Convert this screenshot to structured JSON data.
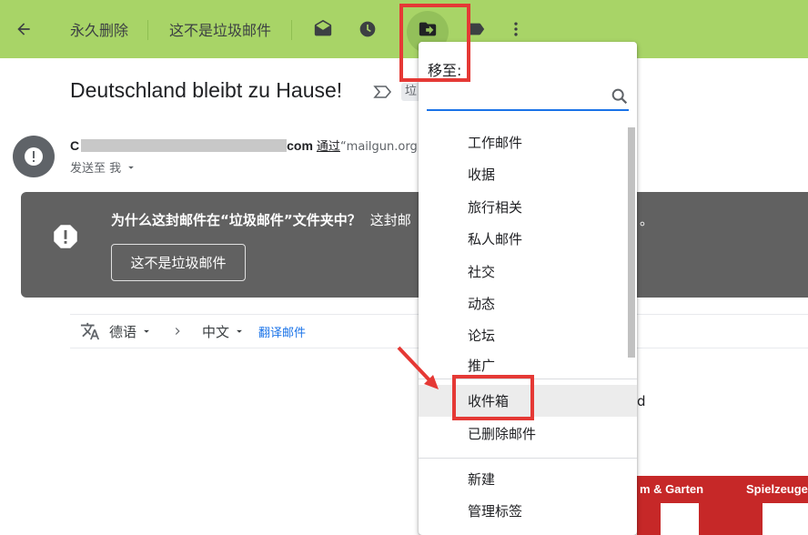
{
  "toolbar": {
    "back_icon": "arrow-left-icon",
    "delete_forever_label": "永久删除",
    "not_spam_label": "这不是垃圾邮件",
    "mark_unread_icon": "envelope-open-icon",
    "snooze_icon": "clock-icon",
    "move_to_icon": "folder-move-icon",
    "labels_icon": "label-icon",
    "more_icon": "more-vert-icon"
  },
  "email": {
    "subject": "Deutschland bleibt zu Hause!",
    "subject_tag": "垃",
    "sender_prefix": "C",
    "sender_suffix": "com",
    "via_label": "通过",
    "via_domain": "“mailgun.org”",
    "to_line": "发送至 我"
  },
  "spam_warning": {
    "question": "为什么这封邮件在“垃圾邮件”文件夹中？",
    "explanation": "这封邮",
    "tail": "。",
    "button_label": "这不是垃圾邮件"
  },
  "translate": {
    "source_lang": "德语",
    "target_lang": "中文",
    "translate_link": "翻译邮件"
  },
  "banner": {
    "item1": "m & Garten",
    "item2": "Spielzeuge"
  },
  "background_glyph": "d",
  "move_menu": {
    "title": "移至:",
    "search_placeholder": "",
    "items": [
      {
        "label": "工作邮件"
      },
      {
        "label": "收据"
      },
      {
        "label": "旅行相关"
      },
      {
        "label": "私人邮件"
      },
      {
        "label": "社交"
      },
      {
        "label": "动态"
      },
      {
        "label": "论坛"
      },
      {
        "label": "推广"
      },
      {
        "label": "收件箱"
      },
      {
        "label": "已删除邮件"
      },
      {
        "label": "新建"
      },
      {
        "label": "管理标签"
      }
    ]
  },
  "colors": {
    "toolbar_bg": "#a8d467",
    "warning_bg": "#616161",
    "annotation_red": "#e53935",
    "link_blue": "#1a73e8",
    "banner_red": "#c62828"
  }
}
